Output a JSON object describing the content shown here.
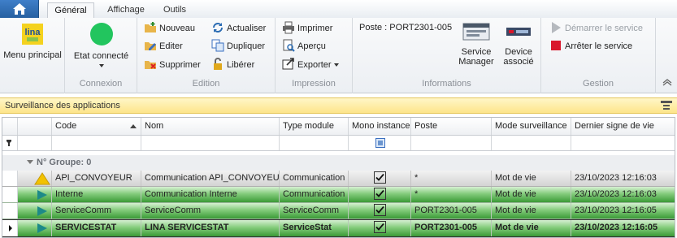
{
  "tabs": [
    {
      "label": "Général",
      "active": true
    },
    {
      "label": "Affichage",
      "active": false
    },
    {
      "label": "Outils",
      "active": false
    }
  ],
  "ribbon": {
    "menu_principal": {
      "label": "Menu principal",
      "logo_text": "lina"
    },
    "connexion": {
      "state_label": "Etat connecté",
      "group_label": "Connexion",
      "state_color": "#22c55e"
    },
    "edition": {
      "group_label": "Edition",
      "nouveau": "Nouveau",
      "editer": "Editer",
      "supprimer": "Supprimer",
      "actualiser": "Actualiser",
      "dupliquer": "Dupliquer",
      "liberer": "Libérer"
    },
    "impression": {
      "group_label": "Impression",
      "imprimer": "Imprimer",
      "apercu": "Aperçu",
      "exporter": "Exporter"
    },
    "informations": {
      "group_label": "Informations",
      "poste": "Poste : PORT2301-005",
      "service_manager_l1": "Service",
      "service_manager_l2": "Manager",
      "device_l1": "Device",
      "device_l2": "associé"
    },
    "gestion": {
      "group_label": "Gestion",
      "demarrer": "Démarrer le service",
      "arreter": "Arrêter le service"
    }
  },
  "panel": {
    "title": "Surveillance des applications"
  },
  "grid": {
    "columns": [
      "Code",
      "Nom",
      "Type module",
      "Mono instance",
      "Poste",
      "Mode surveillance",
      "Dernier signe de vie"
    ],
    "group_label": "N° Groupe: 0",
    "rows": [
      {
        "status": "warning",
        "style": "grey",
        "code": "API_CONVOYEUR",
        "nom": "Communication API_CONVOYEUR",
        "type": "Communication",
        "mono": true,
        "poste": "*",
        "mode": "Mot de vie",
        "date": "23/10/2023 12:16:03"
      },
      {
        "status": "running",
        "style": "green",
        "code": "Interne",
        "nom": "Communication Interne",
        "type": "Communication",
        "mono": true,
        "poste": "*",
        "mode": "Mot de vie",
        "date": "23/10/2023 12:16:03"
      },
      {
        "status": "running",
        "style": "green",
        "code": "ServiceComm",
        "nom": "ServiceComm",
        "type": "ServiceComm",
        "mono": true,
        "poste": "PORT2301-005",
        "mode": "Mot de vie",
        "date": "23/10/2023 12:16:05"
      },
      {
        "status": "running",
        "style": "green",
        "code": "SERVICESTAT",
        "nom": "LINA SERVICESTAT",
        "type": "ServiceStat",
        "mono": true,
        "poste": "PORT2301-005",
        "mode": "Mot de vie",
        "date": "23/10/2023 12:16:05"
      }
    ]
  },
  "colors": {
    "accent": "#2b6cb3",
    "panel_header": "#fde58a",
    "running_green": "#3a9a36",
    "stop_red": "#d9162b",
    "warning_yellow": "#f2c200"
  }
}
